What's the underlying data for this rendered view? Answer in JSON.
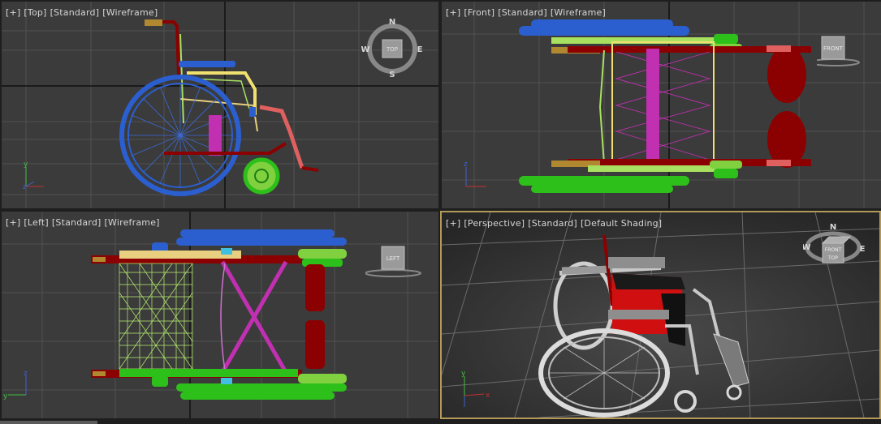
{
  "viewports": {
    "top": {
      "labels": [
        "[+]",
        "[Top]",
        "[Standard]",
        "[Wireframe]"
      ],
      "compass": {
        "n": "N",
        "s": "S",
        "e": "E",
        "w": "W"
      },
      "cube_face": "TOP"
    },
    "front": {
      "labels": [
        "[+]",
        "[Front]",
        "[Standard]",
        "[Wireframe]"
      ],
      "cube_face": "FRONT"
    },
    "left": {
      "labels": [
        "[+]",
        "[Left]",
        "[Standard]",
        "[Wireframe]"
      ],
      "cube_face": "LEFT"
    },
    "perspective": {
      "labels": [
        "[+]",
        "[Perspective]",
        "[Standard]",
        "[Default Shading]"
      ],
      "compass": {
        "n": "N",
        "e": "E",
        "w": "W"
      },
      "cube_face_front": "FRONT",
      "cube_face_top": "TOP"
    }
  },
  "axis_letters": {
    "x": "x",
    "y": "y",
    "z": "z"
  },
  "colors": {
    "viewport_bg": "#3b3b3b",
    "grid": "#505050",
    "grid_axis": "#111111",
    "active_border": "#b39a5a",
    "wheel_blue": "#2b5fd0",
    "frame_red": "#8b0000",
    "magenta": "#c030b0",
    "green": "#2ec01a",
    "light_green": "#a8e060",
    "yellow": "#f0e070"
  }
}
